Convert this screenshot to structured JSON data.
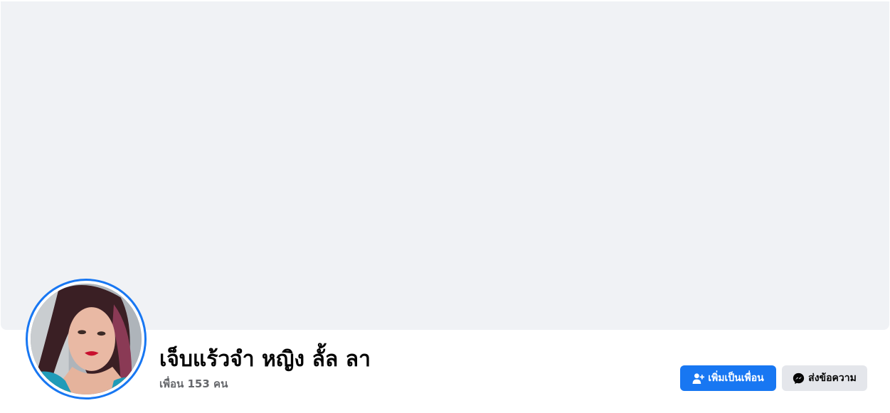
{
  "profile": {
    "name": "เจ็บแร้วจำ หญิง ลั้ล ลา",
    "friends_text": "เพื่อน 153 คน",
    "avatar_alt": "profile photo"
  },
  "actions": {
    "add_friend_label": "เพิ่มเป็นเพื่อน",
    "add_friend_icon": "add-friend-icon",
    "message_label": "ส่งข้อความ",
    "message_icon": "messenger-icon"
  },
  "colors": {
    "accent": "#1877f2",
    "cover": "#f0f2f5",
    "secondary_button": "#e4e6eb",
    "muted_text": "#65676b"
  }
}
